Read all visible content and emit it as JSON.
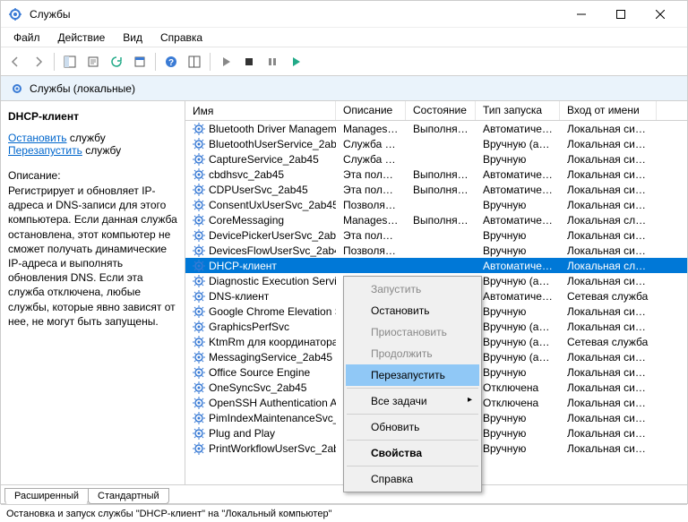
{
  "window": {
    "title": "Службы"
  },
  "menubar": [
    "Файл",
    "Действие",
    "Вид",
    "Справка"
  ],
  "tree_header": "Службы (локальные)",
  "details": {
    "title": "DHCP-клиент",
    "stop_link": "Остановить",
    "stop_suffix": " службу",
    "restart_link": "Перезапустить",
    "restart_suffix": " службу",
    "desc_label": "Описание:",
    "desc_text": "Регистрирует и обновляет IP-адреса и DNS-записи для этого компьютера. Если данная служба остановлена, этот компьютер не сможет получать динамические IP-адреса и выполнять обновления DNS. Если эта служба отключена, любые службы, которые явно зависят от нее, не могут быть запущены."
  },
  "columns": [
    "Имя",
    "Описание",
    "Состояние",
    "Тип запуска",
    "Вход от имени"
  ],
  "services": [
    {
      "name": "Bluetooth Driver Managem…",
      "desc": "Manages B…",
      "state": "Выполняется",
      "startup": "Автоматиче…",
      "logon": "Локальная сис…"
    },
    {
      "name": "BluetoothUserService_2ab45",
      "desc": "Служба п…",
      "state": "",
      "startup": "Вручную (ак…",
      "logon": "Локальная сис…"
    },
    {
      "name": "CaptureService_2ab45",
      "desc": "Служба за…",
      "state": "",
      "startup": "Вручную",
      "logon": "Локальная сис…"
    },
    {
      "name": "cbdhsvc_2ab45",
      "desc": "Эта польз…",
      "state": "Выполняется",
      "startup": "Автоматиче…",
      "logon": "Локальная сис…"
    },
    {
      "name": "CDPUserSvc_2ab45",
      "desc": "Эта польз…",
      "state": "Выполняется",
      "startup": "Автоматиче…",
      "logon": "Локальная сис…"
    },
    {
      "name": "ConsentUxUserSvc_2ab45",
      "desc": "Позволяет…",
      "state": "",
      "startup": "Вручную",
      "logon": "Локальная сис…"
    },
    {
      "name": "CoreMessaging",
      "desc": "Manages c…",
      "state": "Выполняется",
      "startup": "Автоматиче…",
      "logon": "Локальная слу…"
    },
    {
      "name": "DevicePickerUserSvc_2ab45",
      "desc": "Эта польз…",
      "state": "",
      "startup": "Вручную",
      "logon": "Локальная сис…"
    },
    {
      "name": "DevicesFlowUserSvc_2ab45",
      "desc": "Позволяет…",
      "state": "",
      "startup": "Вручную",
      "logon": "Локальная сис…"
    },
    {
      "name": "DHCP-клиент",
      "desc": "",
      "state": "",
      "startup": "Автоматиче…",
      "logon": "Локальная слу…",
      "selected": true
    },
    {
      "name": "Diagnostic Execution Service",
      "desc": "",
      "state": "",
      "startup": "Вручную (ак…",
      "logon": "Локальная сис…"
    },
    {
      "name": "DNS-клиент",
      "desc": "",
      "state": "",
      "startup": "Автоматиче…",
      "logon": "Сетевая служба"
    },
    {
      "name": "Google Chrome Elevation S…",
      "desc": "",
      "state": "",
      "startup": "Вручную",
      "logon": "Локальная сис…"
    },
    {
      "name": "GraphicsPerfSvc",
      "desc": "",
      "state": "",
      "startup": "Вручную (ак…",
      "logon": "Локальная сис…"
    },
    {
      "name": "KtmRm для координатора …",
      "desc": "",
      "state": "",
      "startup": "Вручную (ак…",
      "logon": "Сетевая служба"
    },
    {
      "name": "MessagingService_2ab45",
      "desc": "",
      "state": "",
      "startup": "Вручную (ак…",
      "logon": "Локальная сис…"
    },
    {
      "name": "Office  Source Engine",
      "desc": "",
      "state": "",
      "startup": "Вручную",
      "logon": "Локальная сис…"
    },
    {
      "name": "OneSyncSvc_2ab45",
      "desc": "",
      "state": "",
      "startup": "Отключена",
      "logon": "Локальная сис…"
    },
    {
      "name": "OpenSSH Authentication A…",
      "desc": "",
      "state": "",
      "startup": "Отключена",
      "logon": "Локальная сис…"
    },
    {
      "name": "PimIndexMaintenanceSvc_2…",
      "desc": "",
      "state": "",
      "startup": "Вручную",
      "logon": "Локальная сис…"
    },
    {
      "name": "Plug and Play",
      "desc": "",
      "state": "",
      "startup": "Вручную",
      "logon": "Локальная сис…"
    },
    {
      "name": "PrintWorkflowUserSvc_2ab4…",
      "desc": "",
      "state": "",
      "startup": "Вручную",
      "logon": "Локальная сис…"
    }
  ],
  "context_menu": {
    "start": "Запустить",
    "stop": "Остановить",
    "pause": "Приостановить",
    "resume": "Продолжить",
    "restart": "Перезапустить",
    "all_tasks": "Все задачи",
    "refresh": "Обновить",
    "properties": "Свойства",
    "help": "Справка"
  },
  "bottom_tabs": {
    "extended": "Расширенный",
    "standard": "Стандартный"
  },
  "statusbar": "Остановка и запуск службы \"DHCP-клиент\" на \"Локальный компьютер\""
}
